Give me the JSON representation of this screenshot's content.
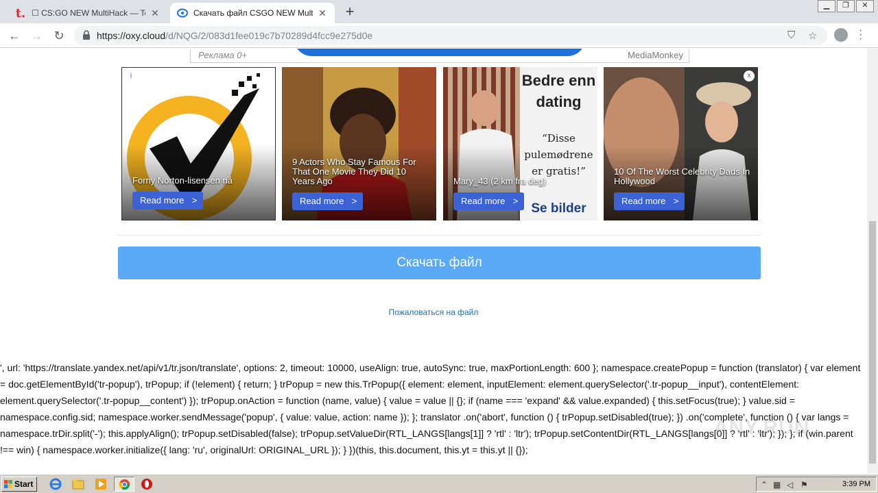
{
  "browser": {
    "tabs": [
      {
        "title": "☐ CS:GO NEW MultiHack — Teletype",
        "favicon": "teletype-t-icon",
        "active": false
      },
      {
        "title": "Скачать файл CSGO NEW MultiHack",
        "favicon": "oxy-cloud-icon",
        "active": true
      }
    ],
    "url_host": "https://oxy.cloud",
    "url_path": "/d/NQG/2/083d1fee019c7b70289d4fcc9e275d0e",
    "accent": "#1a73e8"
  },
  "top_ad": {
    "label": "Реклама 0+",
    "brand": "MediaMonkey"
  },
  "ads": [
    {
      "title": "Forny Norton-lisensen nå",
      "button": "Read more"
    },
    {
      "title": "9 Actors Who Stay Famous For That One Movie They Did 10 Years Ago",
      "button": "Read more"
    },
    {
      "title": "Mary_43 (2 km fra deg)",
      "button": "Read more",
      "side_heading": "Bedre enn dating",
      "side_quote": "“Disse pulemødrene er gratis!”",
      "side_cta": "Se bilder"
    },
    {
      "title": "10 Of The Worst Celebrity Dads In Hollywood",
      "button": "Read more"
    }
  ],
  "ad_info_icon": "i",
  "ad_close_icon": "x",
  "download_button": "Скачать файл",
  "report_link": "Пожаловаться на файл",
  "code_text": "', url: 'https://translate.yandex.net/api/v1/tr.json/translate', options: 2, timeout: 10000, useAlign: true, autoSync: true, maxPortionLength: 600 }; namespace.createPopup = function (translator) { var element = doc.getElementById('tr-popup'), trPopup; if (!element) { return; } trPopup = new this.TrPopup({ element: element, inputElement: element.querySelector('.tr-popup__input'), contentElement: element.querySelector('.tr-popup__content') }); trPopup.onAction = function (name, value) { value = value || {}; if (name === 'expand' && value.expanded) { this.setFocus(true); } value.sid = namespace.config.sid; namespace.worker.sendMessage('popup', { value: value, action: name }); }; translator .on('abort', function () { trPopup.setDisabled(true); }) .on('complete', function () { var langs = namespace.trDir.split('-'); this.applyAlign(); trPopup.setDisabled(false); trPopup.setValueDir(RTL_LANGS[langs[1]] ? 'rtl' : 'ltr'); trPopup.setContentDir(RTL_LANGS[langs[0]] ? 'rtl' : 'ltr'); }); }; if (win.parent !== win) { namespace.worker.initialize({ lang: 'ru', originalUrl: ORIGINAL_URL }); } })(this, this.document, this.yt = this.yt || {});",
  "watermark": "ANY.RUN",
  "taskbar": {
    "start_label": "Start",
    "clock": "3:39 PM"
  }
}
